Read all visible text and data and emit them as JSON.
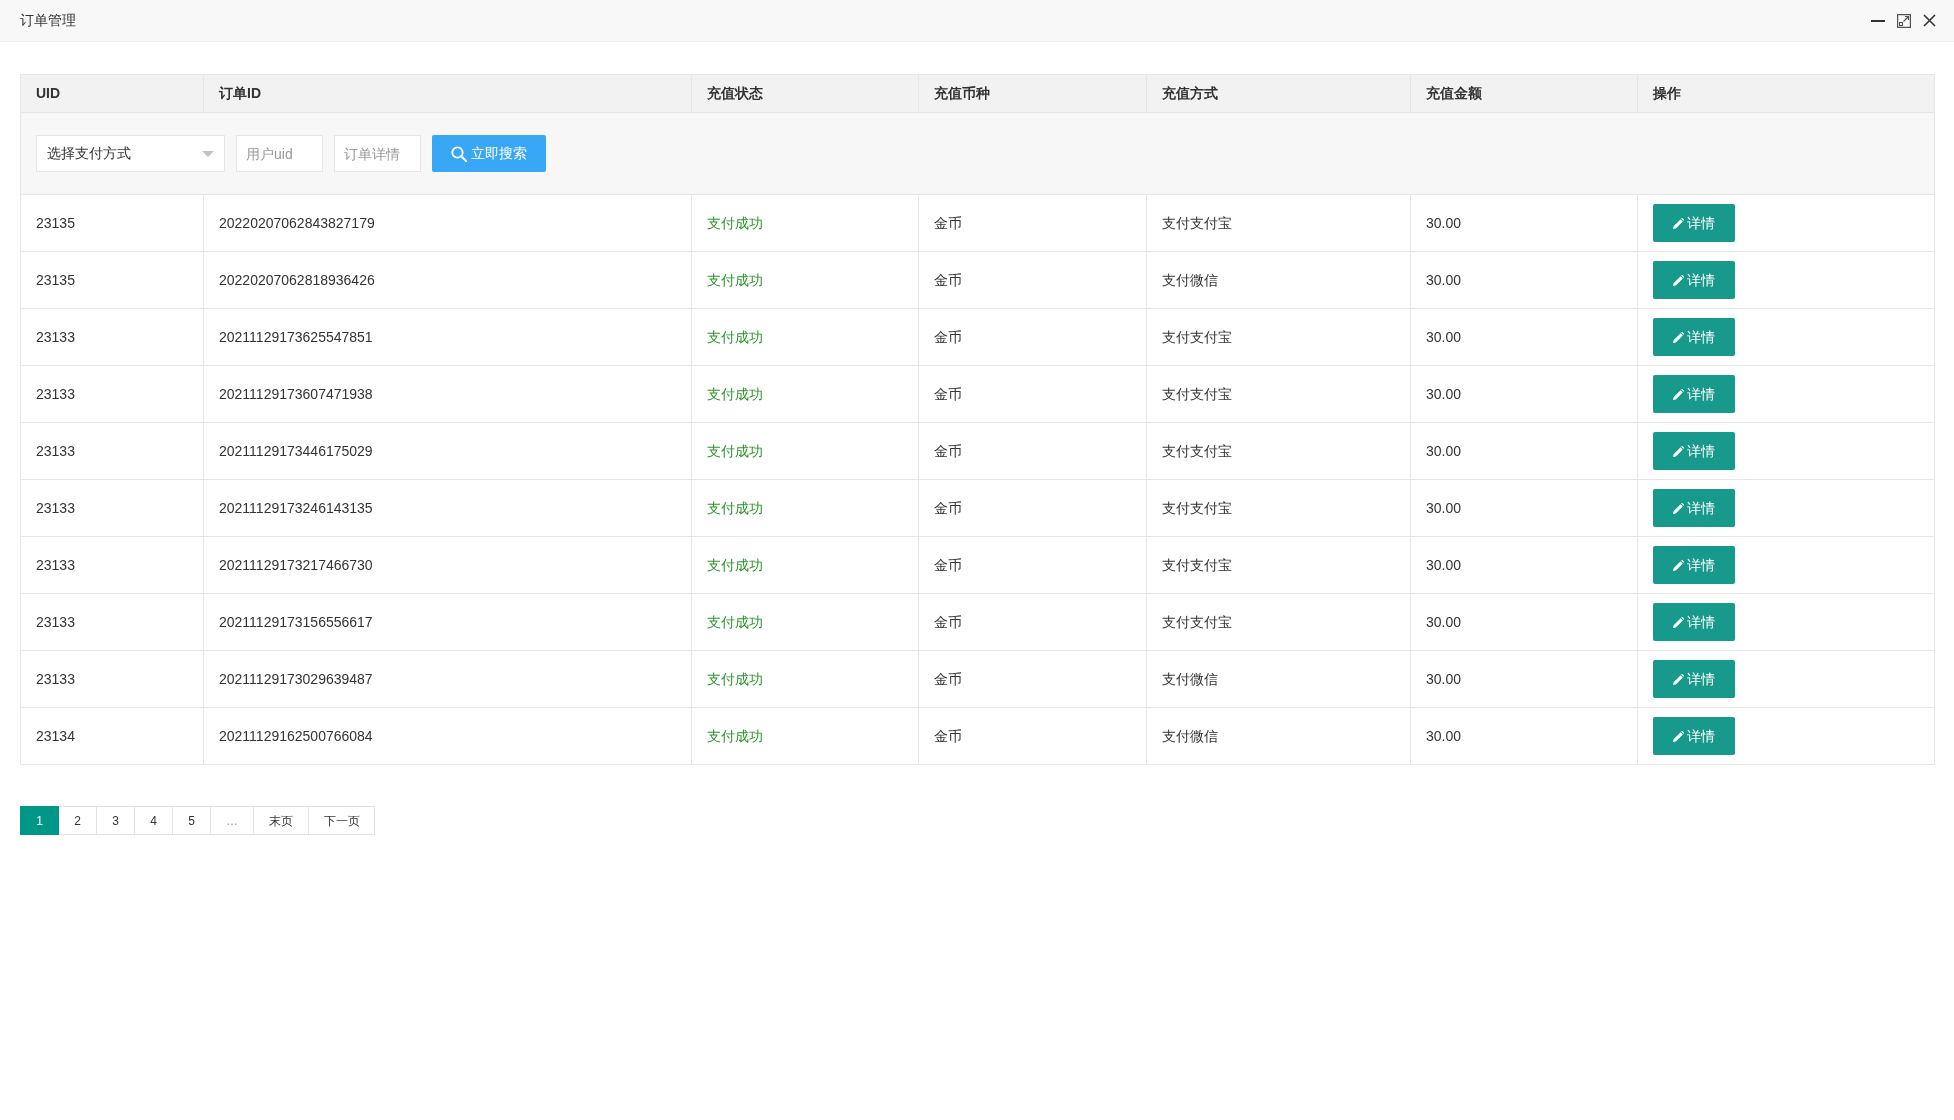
{
  "window": {
    "title": "订单管理"
  },
  "table": {
    "columns": [
      "UID",
      "订单ID",
      "充值状态",
      "充值币种",
      "充值方式",
      "充值金额",
      "操作"
    ],
    "filters": {
      "payment_method": {
        "placeholder": "选择支付方式"
      },
      "user_uid": {
        "placeholder": "用户uid"
      },
      "order_details": {
        "placeholder": "订单详情"
      },
      "search_button": "立即搜索"
    },
    "rows": [
      {
        "uid": "23135",
        "order_id": "20220207062843827179",
        "status": "支付成功",
        "currency": "金币",
        "method": "支付支付宝",
        "amount": "30.00",
        "action": "详情"
      },
      {
        "uid": "23135",
        "order_id": "20220207062818936426",
        "status": "支付成功",
        "currency": "金币",
        "method": "支付微信",
        "amount": "30.00",
        "action": "详情"
      },
      {
        "uid": "23133",
        "order_id": "20211129173625547851",
        "status": "支付成功",
        "currency": "金币",
        "method": "支付支付宝",
        "amount": "30.00",
        "action": "详情"
      },
      {
        "uid": "23133",
        "order_id": "20211129173607471938",
        "status": "支付成功",
        "currency": "金币",
        "method": "支付支付宝",
        "amount": "30.00",
        "action": "详情"
      },
      {
        "uid": "23133",
        "order_id": "20211129173446175029",
        "status": "支付成功",
        "currency": "金币",
        "method": "支付支付宝",
        "amount": "30.00",
        "action": "详情"
      },
      {
        "uid": "23133",
        "order_id": "20211129173246143135",
        "status": "支付成功",
        "currency": "金币",
        "method": "支付支付宝",
        "amount": "30.00",
        "action": "详情"
      },
      {
        "uid": "23133",
        "order_id": "20211129173217466730",
        "status": "支付成功",
        "currency": "金币",
        "method": "支付支付宝",
        "amount": "30.00",
        "action": "详情"
      },
      {
        "uid": "23133",
        "order_id": "20211129173156556617",
        "status": "支付成功",
        "currency": "金币",
        "method": "支付支付宝",
        "amount": "30.00",
        "action": "详情"
      },
      {
        "uid": "23133",
        "order_id": "20211129173029639487",
        "status": "支付成功",
        "currency": "金币",
        "method": "支付微信",
        "amount": "30.00",
        "action": "详情"
      },
      {
        "uid": "23134",
        "order_id": "20211129162500766084",
        "status": "支付成功",
        "currency": "金币",
        "method": "支付微信",
        "amount": "30.00",
        "action": "详情"
      }
    ]
  },
  "pagination": [
    {
      "label": "1",
      "kind": "page",
      "selected": true
    },
    {
      "label": "2",
      "kind": "page",
      "selected": false
    },
    {
      "label": "3",
      "kind": "page",
      "selected": false
    },
    {
      "label": "4",
      "kind": "page",
      "selected": false
    },
    {
      "label": "5",
      "kind": "page",
      "selected": false
    },
    {
      "label": "…",
      "kind": "ellipsis",
      "selected": false
    },
    {
      "label": "末页",
      "kind": "last",
      "selected": false
    },
    {
      "label": "下一页",
      "kind": "next",
      "selected": false
    }
  ]
}
